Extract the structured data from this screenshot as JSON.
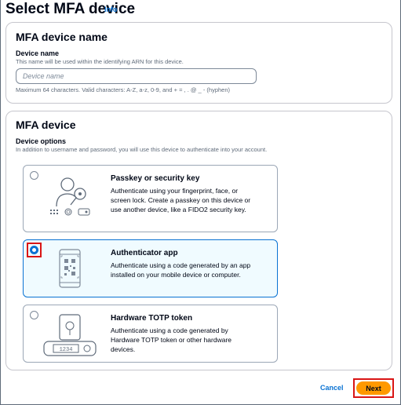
{
  "page": {
    "title": "Select MFA device",
    "info_link": "Info"
  },
  "name_section": {
    "title": "MFA device name",
    "field_label": "Device name",
    "field_description": "This name will be used within the identifying ARN for this device.",
    "input_value": "",
    "input_placeholder": "Device name",
    "constraint_text": "Maximum 64 characters. Valid characters: A-Z, a-z, 0-9, and + = , . @ _ - (hyphen)"
  },
  "device_section": {
    "title": "MFA device",
    "field_label": "Device options",
    "field_description": "In addition to username and password, you will use this device to authenticate into your account.",
    "selected_option": "Authenticator app",
    "options": [
      {
        "title": "Passkey or security key",
        "description": "Authenticate using your fingerprint, face, or screen lock. Create a passkey on this device or use another device, like a FIDO2 security key.",
        "selected": false,
        "icon": "passkey-illustration"
      },
      {
        "title": "Authenticator app",
        "description": "Authenticate using a code generated by an app installed on your mobile device or computer.",
        "selected": true,
        "icon": "authenticator-app-illustration"
      },
      {
        "title": "Hardware TOTP token",
        "description": "Authenticate using a code generated by Hardware TOTP token or other hardware devices.",
        "selected": false,
        "icon": "hardware-token-illustration",
        "token_display": "1234"
      }
    ]
  },
  "footer": {
    "cancel_label": "Cancel",
    "next_label": "Next"
  },
  "colors": {
    "accent": "#0972d3",
    "primary_button": "#ff9900",
    "annotation_highlight": "#d91515"
  }
}
